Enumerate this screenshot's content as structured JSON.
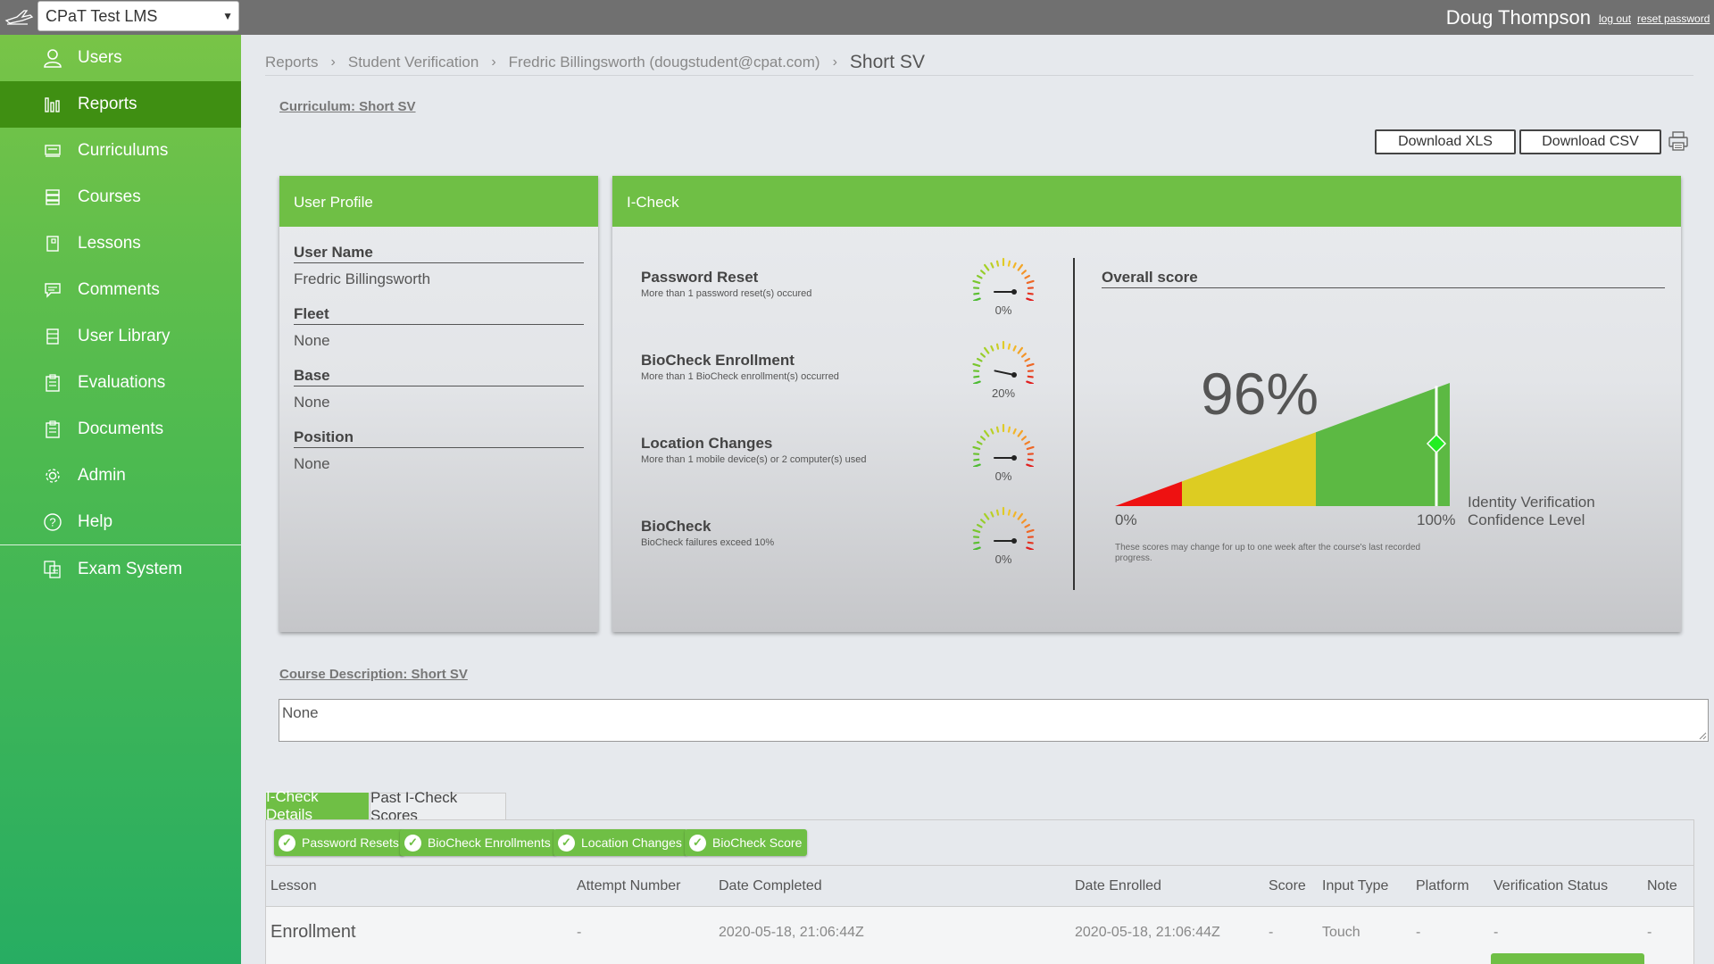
{
  "header": {
    "lms_selected": "CPaT Test LMS",
    "user_name": "Doug Thompson",
    "logout_label": "log out",
    "reset_password_label": "reset password"
  },
  "sidebar": {
    "items": [
      {
        "label": "Users",
        "icon": "user-icon"
      },
      {
        "label": "Reports",
        "icon": "bar-chart-icon",
        "active": true
      },
      {
        "label": "Curriculums",
        "icon": "curriculum-icon"
      },
      {
        "label": "Courses",
        "icon": "stack-icon"
      },
      {
        "label": "Lessons",
        "icon": "lesson-icon"
      },
      {
        "label": "Comments",
        "icon": "comment-icon"
      },
      {
        "label": "User Library",
        "icon": "library-icon"
      },
      {
        "label": "Evaluations",
        "icon": "clipboard-icon"
      },
      {
        "label": "Documents",
        "icon": "clipboard-icon"
      },
      {
        "label": "Admin",
        "icon": "gear-icon"
      },
      {
        "label": "Help",
        "icon": "help-icon"
      },
      {
        "label": "Exam System",
        "icon": "exam-icon"
      }
    ]
  },
  "breadcrumb": {
    "items": [
      "Reports",
      "Student Verification",
      "Fredric Billingsworth (dougstudent@cpat.com)"
    ],
    "current": "Short SV"
  },
  "curriculum_title": "Curriculum: Short SV",
  "downloads": {
    "xls": "Download XLS",
    "csv": "Download CSV"
  },
  "user_profile": {
    "title": "User Profile",
    "fields": [
      {
        "label": "User Name",
        "value": "Fredric Billingsworth"
      },
      {
        "label": "Fleet",
        "value": "None"
      },
      {
        "label": "Base",
        "value": "None"
      },
      {
        "label": "Position",
        "value": "None"
      }
    ]
  },
  "icheck": {
    "title": "I-Check",
    "metrics": [
      {
        "title": "Password Reset",
        "subtitle": "More than 1 password reset(s) occured",
        "percent_label": "0%",
        "percent": 0
      },
      {
        "title": "BioCheck Enrollment",
        "subtitle": "More than 1 BioCheck enrollment(s) occurred",
        "percent_label": "20%",
        "percent": 20
      },
      {
        "title": "Location Changes",
        "subtitle": "More than 1 mobile device(s) or 2 computer(s) used",
        "percent_label": "0%",
        "percent": 0
      },
      {
        "title": "BioCheck",
        "subtitle": "BioCheck failures exceed 10%",
        "percent_label": "0%",
        "percent": 0
      }
    ],
    "overall": {
      "title": "Overall score",
      "score_label": "96%",
      "score": 96,
      "axis_min_label": "0%",
      "axis_max_label": "100%",
      "caption_line1": "Identity Verification",
      "caption_line2": "Confidence Level",
      "note": "These scores may change for up to one week after the course's last recorded progress.",
      "colors": {
        "red": "#ee1111",
        "yellow": "#ddcc22",
        "green": "#5cb943",
        "marker": "#22ee22"
      }
    }
  },
  "course_description": {
    "title": "Course Description: Short SV",
    "value": "None"
  },
  "tabs": [
    {
      "label": "I-Check Details",
      "active": true
    },
    {
      "label": "Past I-Check Scores",
      "active": false
    }
  ],
  "filters": [
    "Password Resets",
    "BioCheck Enrollments",
    "Location Changes",
    "BioCheck Score"
  ],
  "table": {
    "columns": [
      "Lesson",
      "Attempt Number",
      "Date Completed",
      "Date Enrolled",
      "Score",
      "Input Type",
      "Platform",
      "Verification Status",
      "Note"
    ],
    "rows": [
      [
        "Enrollment",
        "-",
        "2020-05-18, 21:06:44Z",
        "2020-05-18, 21:06:44Z",
        "-",
        "Touch",
        "-",
        "-",
        "-"
      ]
    ]
  },
  "accent_color": "#6fbf45"
}
